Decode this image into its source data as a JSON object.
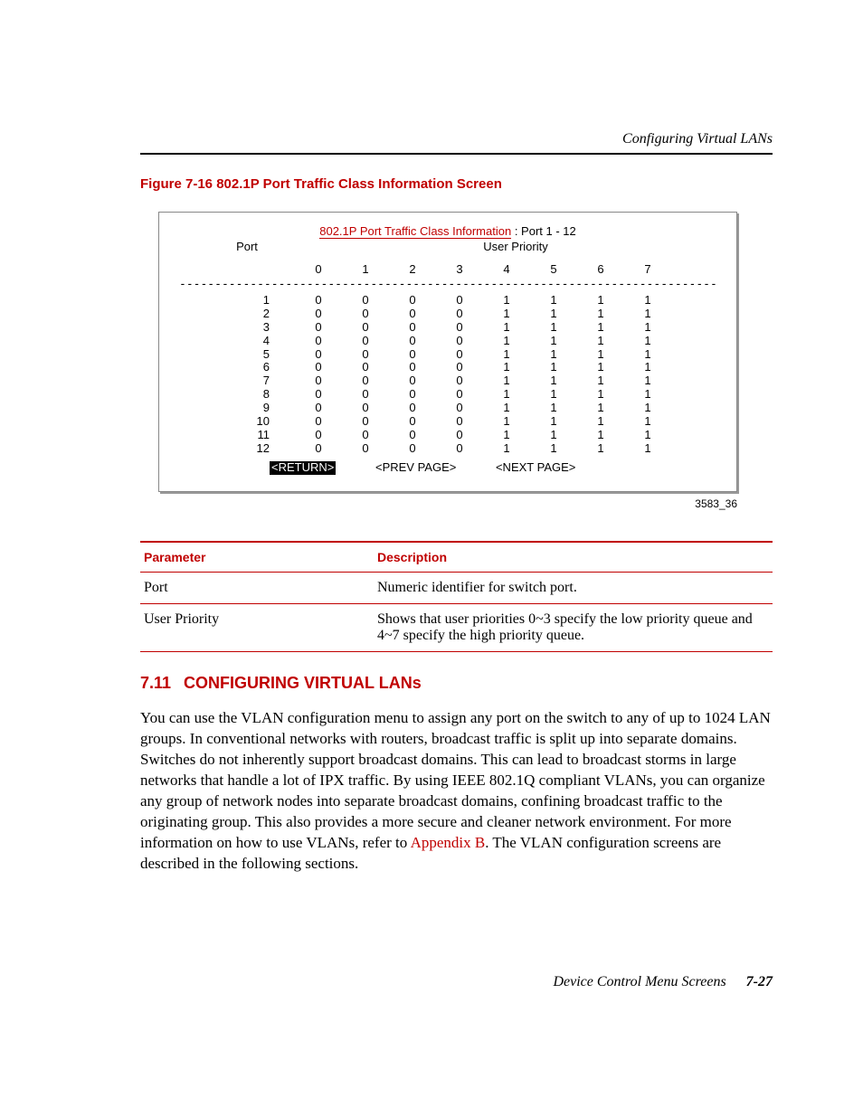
{
  "running_head": "Configuring Virtual LANs",
  "figure": {
    "caption": "Figure 7-16   802.1P Port Traffic Class Information Screen",
    "screen_title_red": "802.1P Port Traffic Class Information",
    "screen_title_suffix": " : Port  1 - 12",
    "port_label": "Port",
    "user_priority_label": "User Priority",
    "priority_cols": [
      "0",
      "1",
      "2",
      "3",
      "4",
      "5",
      "6",
      "7"
    ],
    "rows": [
      {
        "port": "1",
        "vals": [
          "0",
          "0",
          "0",
          "0",
          "1",
          "1",
          "1",
          "1"
        ]
      },
      {
        "port": "2",
        "vals": [
          "0",
          "0",
          "0",
          "0",
          "1",
          "1",
          "1",
          "1"
        ]
      },
      {
        "port": "3",
        "vals": [
          "0",
          "0",
          "0",
          "0",
          "1",
          "1",
          "1",
          "1"
        ]
      },
      {
        "port": "4",
        "vals": [
          "0",
          "0",
          "0",
          "0",
          "1",
          "1",
          "1",
          "1"
        ]
      },
      {
        "port": "5",
        "vals": [
          "0",
          "0",
          "0",
          "0",
          "1",
          "1",
          "1",
          "1"
        ]
      },
      {
        "port": "6",
        "vals": [
          "0",
          "0",
          "0",
          "0",
          "1",
          "1",
          "1",
          "1"
        ]
      },
      {
        "port": "7",
        "vals": [
          "0",
          "0",
          "0",
          "0",
          "1",
          "1",
          "1",
          "1"
        ]
      },
      {
        "port": "8",
        "vals": [
          "0",
          "0",
          "0",
          "0",
          "1",
          "1",
          "1",
          "1"
        ]
      },
      {
        "port": "9",
        "vals": [
          "0",
          "0",
          "0",
          "0",
          "1",
          "1",
          "1",
          "1"
        ]
      },
      {
        "port": "10",
        "vals": [
          "0",
          "0",
          "0",
          "0",
          "1",
          "1",
          "1",
          "1"
        ]
      },
      {
        "port": "11",
        "vals": [
          "0",
          "0",
          "0",
          "0",
          "1",
          "1",
          "1",
          "1"
        ]
      },
      {
        "port": "12",
        "vals": [
          "0",
          "0",
          "0",
          "0",
          "1",
          "1",
          "1",
          "1"
        ]
      }
    ],
    "btn_return": "<RETURN>",
    "btn_prev": "<PREV PAGE>",
    "btn_next": "<NEXT PAGE>",
    "fig_id": "3583_36"
  },
  "param_table": {
    "h_param": "Parameter",
    "h_desc": "Description",
    "rows": [
      {
        "p": "Port",
        "d": "Numeric identifier for switch port."
      },
      {
        "p": "User Priority",
        "d": "Shows that user priorities 0~3 specify the low priority queue and 4~7 specify the high priority queue."
      }
    ]
  },
  "section": {
    "num": "7.11",
    "title": "CONFIGURING VIRTUAL LANs",
    "para_before_xref": "You can use the VLAN configuration menu to assign any port on the switch to any of up to 1024 LAN groups. In conventional networks with routers, broadcast traffic is split up into separate domains. Switches do not inherently support broadcast domains. This can lead to broadcast storms in large networks that handle a lot of IPX traffic. By using IEEE 802.1Q compliant VLANs, you can organize any group of network nodes into separate broadcast domains, confining broadcast traffic to the originating group. This also provides a more secure and cleaner network environment. For more information on how to use VLANs, refer to ",
    "xref": "Appendix B",
    "para_after_xref": ". The VLAN configuration screens are described in the following sections."
  },
  "footer": {
    "text": "Device Control Menu Screens",
    "page": "7-27"
  }
}
